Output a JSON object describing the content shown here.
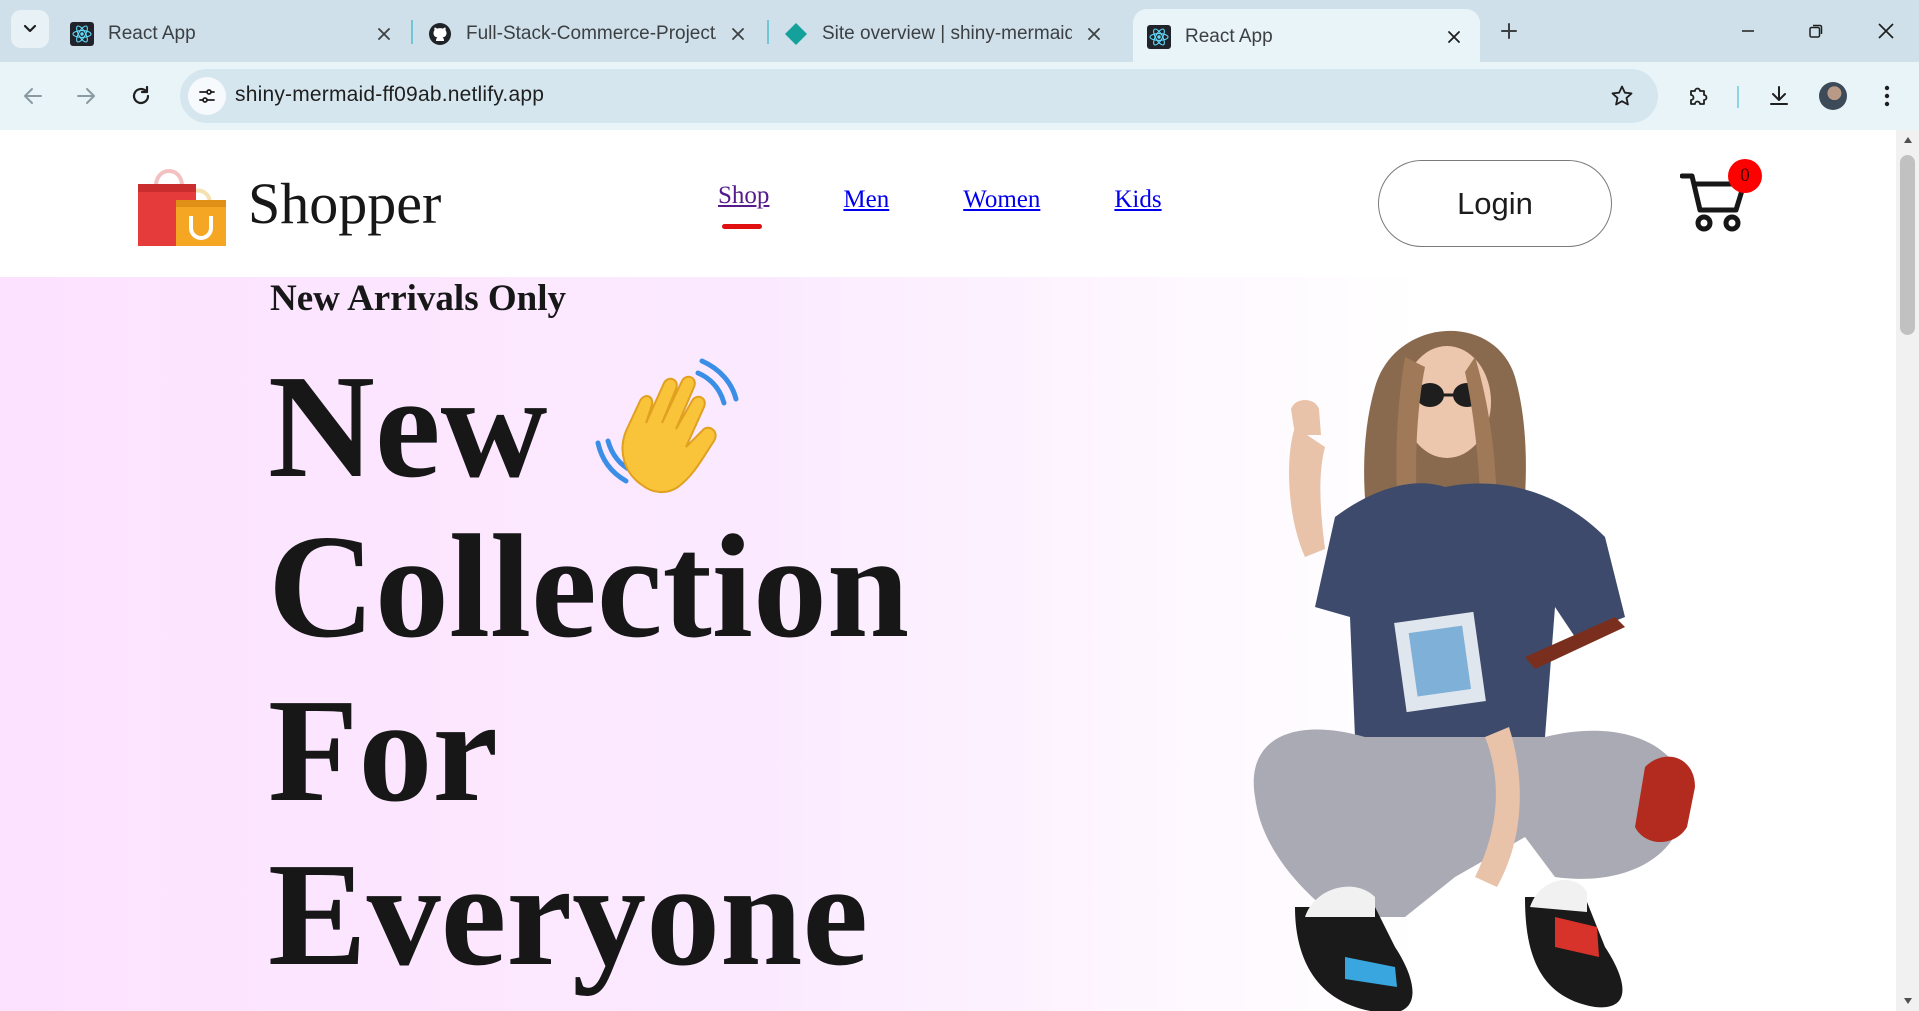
{
  "browser": {
    "tabs": [
      {
        "title": "React App",
        "active": false,
        "favicon": "react-icon"
      },
      {
        "title": "Full-Stack-Commerce-Project/sr",
        "active": false,
        "favicon": "github-icon"
      },
      {
        "title": "Site overview | shiny-mermaid-f",
        "active": false,
        "favicon": "netlify-icon"
      },
      {
        "title": "React App",
        "active": true,
        "favicon": "react-icon"
      }
    ],
    "url": "shiny-mermaid-ff09ab.netlify.app"
  },
  "site": {
    "brand": "Shopper",
    "menu": {
      "shop": "Shop",
      "men": "Men",
      "women": "Women",
      "kids": "Kids"
    },
    "login_label": "Login",
    "cart_count": "0"
  },
  "hero": {
    "kicker": "New Arrivals Only",
    "line1": "New",
    "line2": "Collection",
    "line3": "For",
    "line4": "Everyone"
  },
  "colors": {
    "accent_underline": "#e01010",
    "cart_badge": "#ff0000",
    "hero_gradient_start": "#fde2ff"
  }
}
